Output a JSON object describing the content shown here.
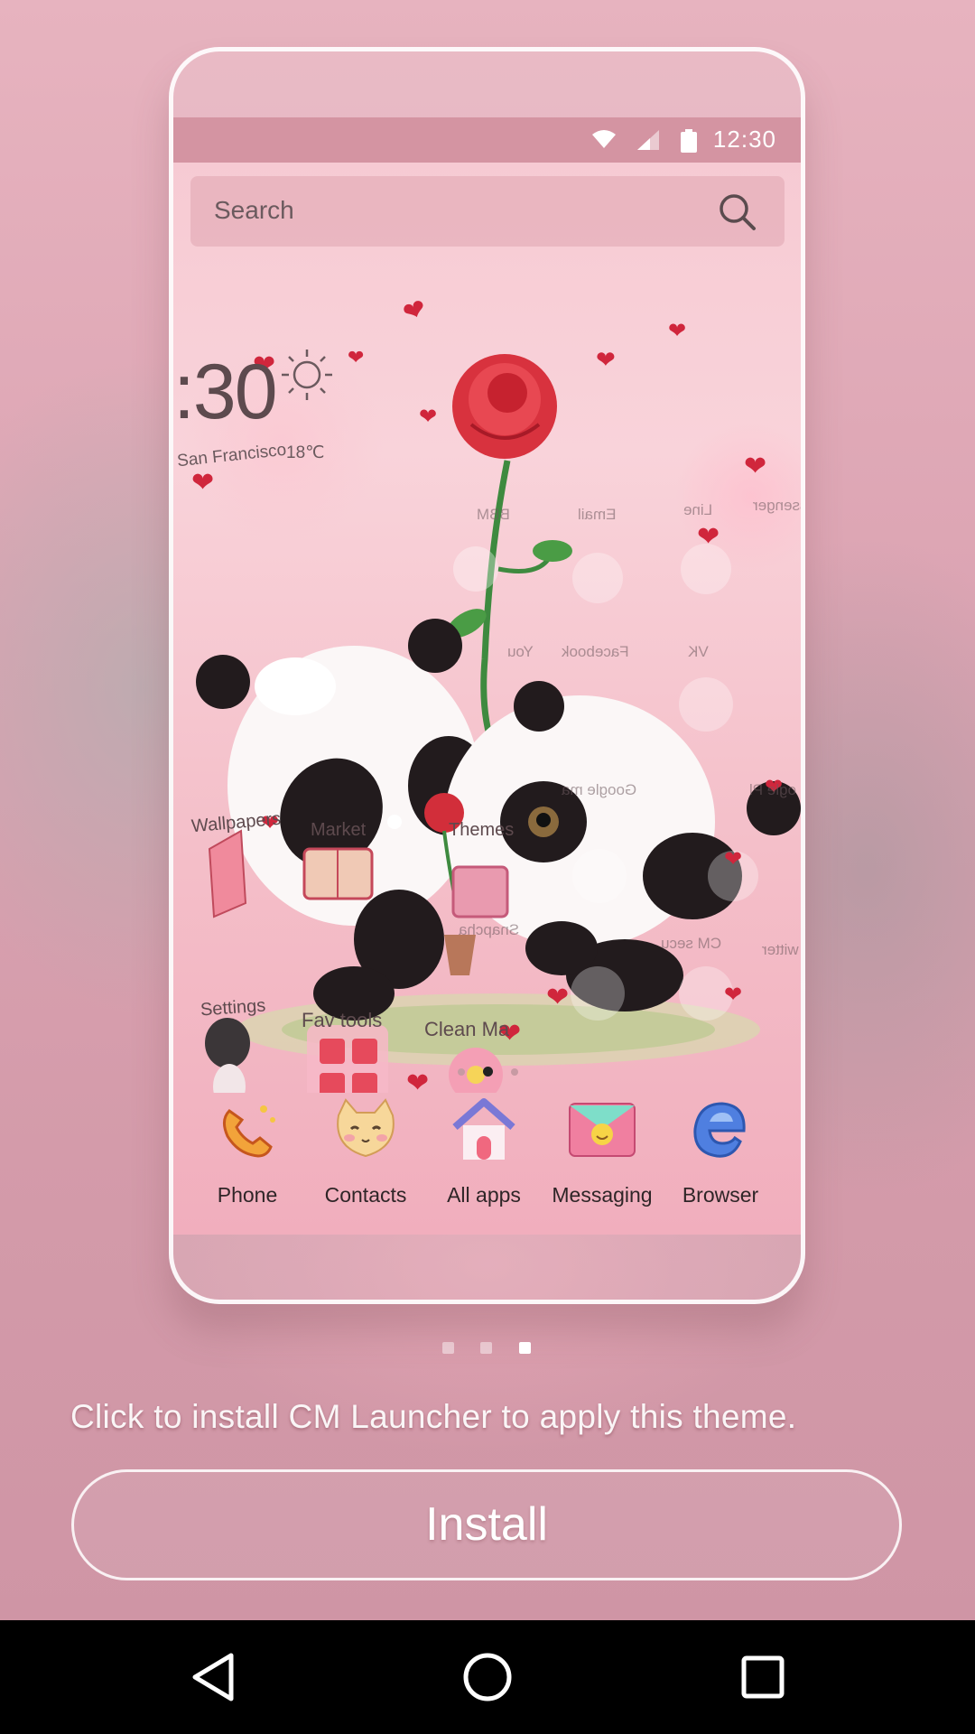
{
  "status_bar": {
    "time": "12:30"
  },
  "search": {
    "placeholder": "Search"
  },
  "weather_widget": {
    "time": ":30",
    "city": "San Francisco",
    "temperature": "18℃"
  },
  "home_labels": {
    "wallpapers": "Wallpapers",
    "market": "Market",
    "themes": "Themes",
    "settings": "Settings",
    "fav_tools": "Fav tools",
    "clean_master": "Clean Ma",
    "bbm": "BBM",
    "email": "Email",
    "line": "Line",
    "messenger": "ssenger",
    "you": "You",
    "facebook": "Facebook",
    "vk": "VK",
    "google_maps": "Google ma",
    "google_play": "ogle Pl",
    "snapchat": "Snapcha",
    "cm_security": "CM secu",
    "twitter": "witter"
  },
  "dock": [
    {
      "label": "Phone",
      "icon": "phone-icon"
    },
    {
      "label": "Contacts",
      "icon": "cat-contacts-icon"
    },
    {
      "label": "All apps",
      "icon": "house-icon"
    },
    {
      "label": "Messaging",
      "icon": "envelope-icon"
    },
    {
      "label": "Browser",
      "icon": "browser-e-icon"
    }
  ],
  "screen_pager": {
    "pages": 3,
    "active": 2
  },
  "preview_pager": {
    "pages": 3,
    "active": 3
  },
  "message": "Click to install CM Launcher to apply this theme.",
  "install_button": "Install",
  "colors": {
    "background": "#dba3b2",
    "heart": "#d0263c",
    "nav_bar": "#000000"
  }
}
